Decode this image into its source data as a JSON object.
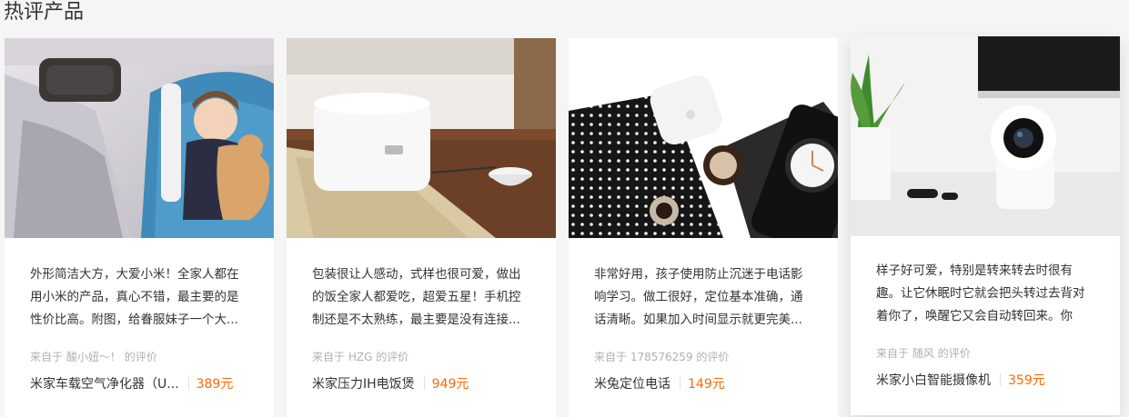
{
  "section": {
    "title": "热评产品"
  },
  "cards": [
    {
      "review": "外形简洁大方，大爱小米！全家人都在用小米的产品，真心不错，最主要的是性价比高。附图，给眷服妹子一个大...",
      "author_prefix": "来自于",
      "author": "酸小妞～！",
      "author_suffix": "的评价",
      "product": "米家车载空气净化器（U...",
      "price": "389元"
    },
    {
      "review": "包装很让人感动，式样也很可爱，做出的饭全家人都爱吃，超爱五星！手机控制还是不太熟练，最主要是没有连接...",
      "author_prefix": "来自于",
      "author": "HZG",
      "author_suffix": "的评价",
      "product": "米家压力IH电饭煲",
      "price": "949元"
    },
    {
      "review": "非常好用，孩子使用防止沉迷于电话影响学习。做工很好，定位基本准确，通话清晰。如果加入时间显示就更完美...",
      "author_prefix": "来自于",
      "author": "178576259",
      "author_suffix": "的评价",
      "product": "米兔定位电话",
      "price": "149元"
    },
    {
      "review": "样子好可爱，特别是转来转去时很有趣。让它休眠时它就会把头转过去背对着你了，唤醒它又会自动转回来。你",
      "author_prefix": "来自于",
      "author": "随风",
      "author_suffix": "的评价",
      "product": "米家小白智能摄像机",
      "price": "359元"
    }
  ]
}
